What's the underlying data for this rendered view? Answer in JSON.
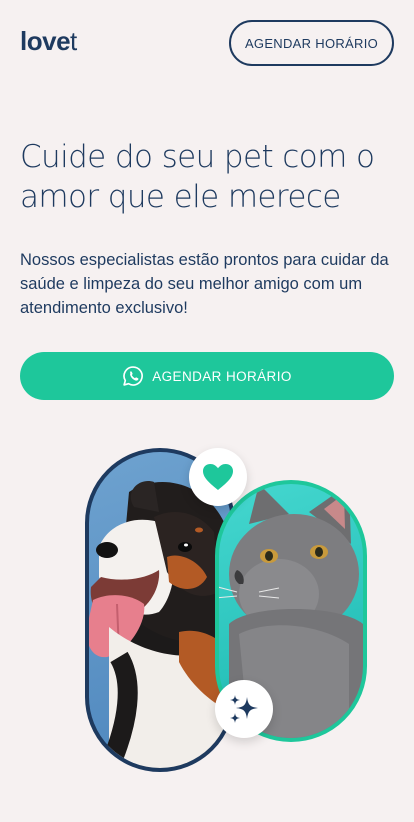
{
  "header": {
    "logo_main": "love",
    "logo_suffix": "t",
    "cta_label": "AGENDAR HORÁRIO"
  },
  "hero": {
    "title": "Cuide do seu pet com o amor que ele merece",
    "description": "Nossos especialistas estão prontos para cuidar da saúde e limpeza do seu melhor amigo com um atendimento exclusivo!",
    "cta_label": "AGENDAR HORÁRIO",
    "cta_icon": "whatsapp-icon"
  },
  "illustration": {
    "badges": [
      "heart-icon",
      "sparkle-icon"
    ]
  },
  "colors": {
    "primary": "#1e3a5f",
    "accent": "#1ec79b",
    "background": "#f6f1f1"
  }
}
